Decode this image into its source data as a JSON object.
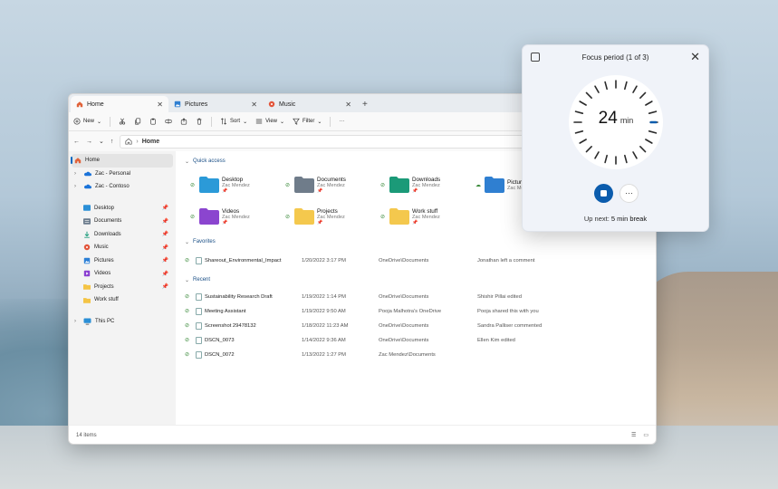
{
  "explorer": {
    "tabs": [
      {
        "label": "Home",
        "icon": "home-icon",
        "active": true
      },
      {
        "label": "Pictures",
        "icon": "pictures-icon",
        "active": false
      },
      {
        "label": "Music",
        "icon": "music-icon",
        "active": false
      }
    ],
    "toolbar": {
      "new_label": "New",
      "sort_label": "Sort",
      "view_label": "View",
      "filter_label": "Filter",
      "more_label": "···"
    },
    "address": {
      "path": "Home"
    },
    "sidebar": {
      "top": [
        {
          "label": "Home",
          "icon": "home-icon"
        },
        {
          "label": "Zac - Personal",
          "icon": "onedrive-icon"
        },
        {
          "label": "Zac - Contoso",
          "icon": "onedrive-icon"
        }
      ],
      "pinned": [
        {
          "label": "Desktop",
          "icon": "desktop-folder-icon",
          "color": "#2b8fd6"
        },
        {
          "label": "Documents",
          "icon": "documents-folder-icon",
          "color": "#6b7b8c"
        },
        {
          "label": "Downloads",
          "icon": "downloads-folder-icon",
          "color": "#1a9b7a"
        },
        {
          "label": "Music",
          "icon": "music-folder-icon",
          "color": "#e2553b"
        },
        {
          "label": "Pictures",
          "icon": "pictures-folder-icon",
          "color": "#2b7fd6"
        },
        {
          "label": "Videos",
          "icon": "videos-folder-icon",
          "color": "#8a3fd1"
        },
        {
          "label": "Projects",
          "icon": "folder-icon",
          "color": "#f4c445"
        },
        {
          "label": "Work stuff",
          "icon": "folder-icon",
          "color": "#f4c445"
        }
      ],
      "this_pc": "This PC"
    },
    "quick_access": {
      "heading": "Quick access",
      "items": [
        {
          "name": "Desktop",
          "owner": "Zac Mendez",
          "pinned": true,
          "color": "#2b9ad8"
        },
        {
          "name": "Documents",
          "owner": "Zac Mendez",
          "pinned": true,
          "color": "#6f7c8a"
        },
        {
          "name": "Downloads",
          "owner": "Zac Mendez",
          "pinned": true,
          "color": "#1b9a78"
        },
        {
          "name": "Pictures",
          "owner": "Zac Mendez",
          "pinned": false,
          "color": "#2f7fd1"
        },
        {
          "name": "Videos",
          "owner": "Zac Mendez",
          "pinned": true,
          "color": "#8b45cf"
        },
        {
          "name": "Projects",
          "owner": "Zac Mendez",
          "pinned": true,
          "color": "#f4c84d"
        },
        {
          "name": "Work stuff",
          "owner": "Zac Mendez",
          "pinned": true,
          "color": "#f4c84d"
        }
      ]
    },
    "favorites": {
      "heading": "Favorites",
      "rows": [
        {
          "name": "Shareout_Environmental_Impact",
          "date": "1/20/2022 3:17 PM",
          "location": "OneDrive\\Documents",
          "activity": "Jonathan left a comment"
        }
      ]
    },
    "recent": {
      "heading": "Recent",
      "rows": [
        {
          "name": "Sustainability Research Draft",
          "date": "1/19/2022 1:14 PM",
          "location": "OneDrive\\Documents",
          "activity": "Shishir Pillai edited"
        },
        {
          "name": "Meeting Assistant",
          "date": "1/19/2022 9:50 AM",
          "location": "Pooja Malhotra's OneDrive",
          "activity": "Pooja shared this with you"
        },
        {
          "name": "Screenshot 29478132",
          "date": "1/18/2022 11:23 AM",
          "location": "OneDrive\\Documents",
          "activity": "Sandra Palliser commented"
        },
        {
          "name": "DSCN_0073",
          "date": "1/14/2022 9:36 AM",
          "location": "OneDrive\\Documents",
          "activity": "Ellen Kim edited"
        },
        {
          "name": "DSCN_0072",
          "date": "1/13/2022 1:27 PM",
          "location": "Zac Mendez\\Documents",
          "activity": ""
        }
      ]
    },
    "status": {
      "item_count": "14 items"
    }
  },
  "focus": {
    "title": "Focus period (1 of 3)",
    "minutes": "24",
    "unit": "min",
    "remaining_fraction": 0.96,
    "upnext_prefix": "Up next:",
    "upnext_value": "5 min break",
    "accent": "#0b5cad"
  }
}
